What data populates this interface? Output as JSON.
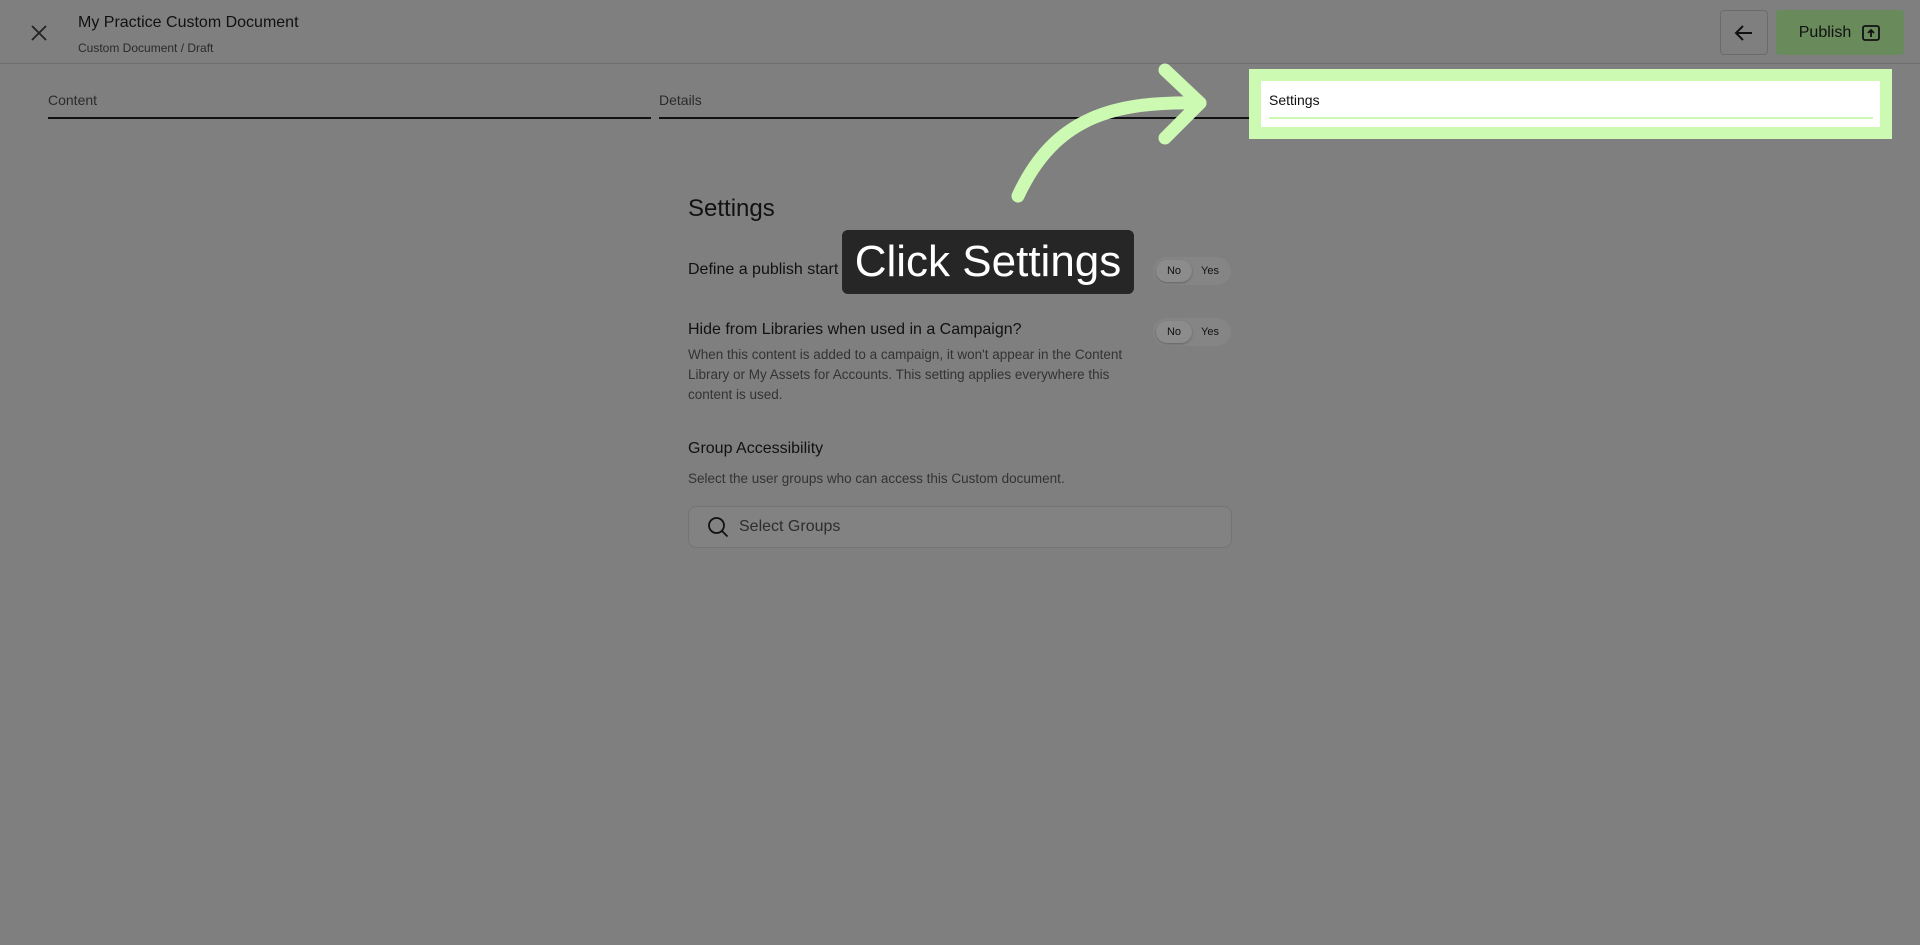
{
  "header": {
    "title": "My Practice Custom Document",
    "breadcrumb": "Custom Document / Draft",
    "publish_label": "Publish"
  },
  "tabs": [
    {
      "label": "Content"
    },
    {
      "label": "Details"
    },
    {
      "label": "Settings",
      "active": true
    }
  ],
  "settings": {
    "title": "Settings",
    "publish_window": {
      "label": "Define a publish start and end date?",
      "no": "No",
      "yes": "Yes",
      "selected": "No"
    },
    "hide_from_libraries": {
      "label": "Hide from Libraries when used in a Campaign?",
      "description": "When this content is added to a campaign, it won't appear in the Content Library or My Assets for Accounts. This setting applies everywhere this content is used.",
      "no": "No",
      "yes": "Yes",
      "selected": "No"
    },
    "group_accessibility": {
      "label": "Group Accessibility",
      "description": "Select the user groups who can access this Custom document.",
      "placeholder": "Select Groups"
    }
  },
  "tutorial": {
    "callout_text": "Click Settings",
    "highlight_color": "#cdfab3"
  },
  "icons": {
    "close": "close-icon",
    "back": "arrow-left-icon",
    "publish": "publish-icon",
    "search": "search-icon"
  }
}
